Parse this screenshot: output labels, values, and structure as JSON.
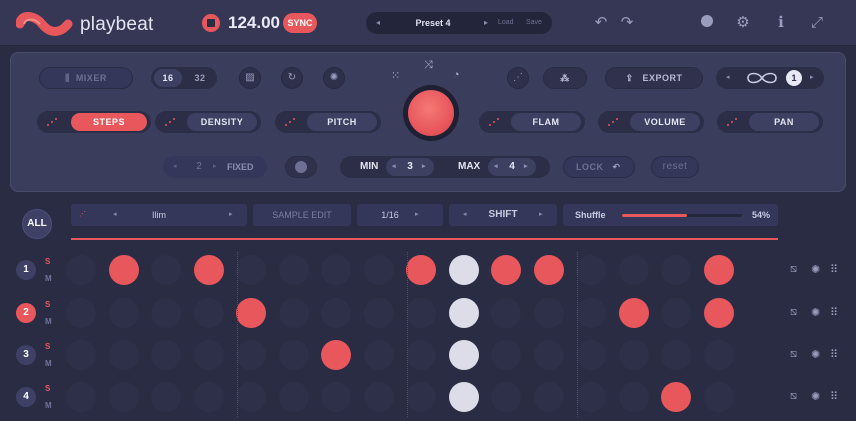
{
  "app": {
    "brand": "playbeat",
    "bpm": "124.00",
    "sync_label": "SYNC"
  },
  "preset": {
    "prev": "◂",
    "name": "Preset 4",
    "next": "▸",
    "load": "Load",
    "save": "Save"
  },
  "controls": {
    "mixer": "MIXER",
    "len_a": "16",
    "len_b": "32",
    "export": "EXPORT",
    "loop_value": "1",
    "steps": "STEPS",
    "density": "DENSITY",
    "pitch": "PITCH",
    "flam": "FLAM",
    "volume": "VOLUME",
    "pan": "PAN",
    "fixed_value": "2",
    "fixed_label": "FIXED",
    "min_label": "MIN",
    "min_value": "3",
    "max_label": "MAX",
    "max_value": "4",
    "lock": "LOCK",
    "reset": "reset"
  },
  "sequencer": {
    "all": "ALL",
    "bar_left": "Ilim",
    "sample_edit": "SAMPLE EDIT",
    "division": "1/16",
    "shift": "SHIFT",
    "shuffle_label": "Shuffle",
    "shuffle_value": "54%",
    "shuffle_level": 0.54,
    "solo": "S",
    "mute": "M",
    "rows": [
      {
        "num": "1",
        "active": false,
        "steps": [
          0,
          1,
          0,
          1,
          0,
          0,
          0,
          0,
          1,
          2,
          1,
          1,
          0,
          0,
          0,
          1
        ]
      },
      {
        "num": "2",
        "active": true,
        "steps": [
          0,
          0,
          0,
          0,
          1,
          0,
          0,
          0,
          0,
          2,
          0,
          0,
          0,
          1,
          0,
          1
        ]
      },
      {
        "num": "3",
        "active": false,
        "steps": [
          0,
          0,
          0,
          0,
          0,
          0,
          1,
          0,
          0,
          2,
          0,
          0,
          0,
          0,
          0,
          0
        ]
      },
      {
        "num": "4",
        "active": false,
        "steps": [
          0,
          0,
          0,
          0,
          0,
          0,
          0,
          0,
          0,
          2,
          0,
          0,
          0,
          0,
          1,
          0
        ]
      }
    ]
  },
  "colors": {
    "accent": "#e8575c",
    "playhead": "#dcdde9",
    "bg": "#2a2c44",
    "panel": "#3b3d5c"
  }
}
